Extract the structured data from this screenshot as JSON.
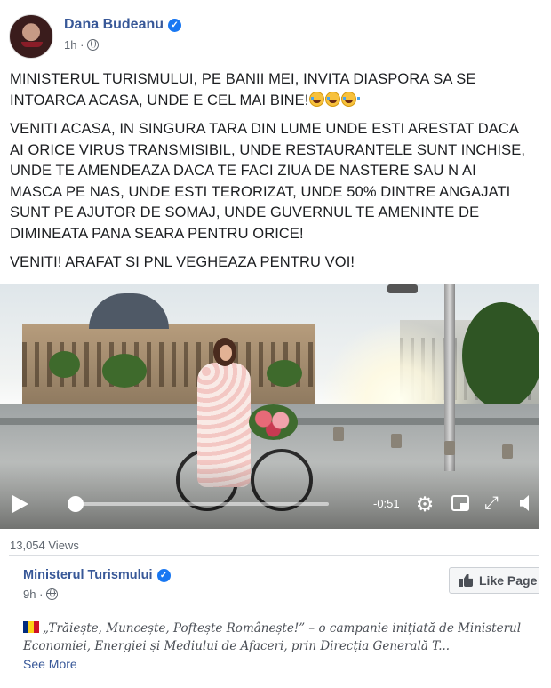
{
  "post": {
    "author": "Dana Budeanu",
    "time": "1h",
    "paragraphs": [
      "MINISTERUL TURISMULUI, PE BANII MEI, INVITA DIASPORA SA SE",
      "INTOARCA ACASA, UNDE E CEL MAI BINE!",
      "VENITI ACASA, IN SINGURA TARA DIN LUME UNDE ESTI ARESTAT DACA",
      "AI ORICE VIRUS TRANSMISIBIL, UNDE RESTAURANTELE SUNT INCHISE,",
      "UNDE TE AMENDEAZA DACA TE FACI ZIUA DE NASTERE SAU N AI",
      "MASCA PE NAS, UNDE ESTI TERORIZAT, UNDE 50% DINTRE ANGAJATI",
      "SUNT PE AJUTOR DE SOMAJ, UNDE GUVERNUL TE AMENINTE DE",
      "DIMINEATA PANA SEARA PENTRU ORICE!",
      "VENITI! ARAFAT SI PNL VEGHEAZA PENTRU VOI!"
    ]
  },
  "video": {
    "time_remaining": "-0:51",
    "progress": 0.01,
    "views": "13,054 Views"
  },
  "shared_page": {
    "name": "Ministerul Turismului",
    "time": "9h",
    "like_button": "Like Page",
    "description_line1": "„Trăiește, Muncește, Poftește Românește!” – o campanie inițiată de Ministerul",
    "description_line2": "Economiei, Energiei și Mediului de Afaceri, prin Direcția Generală T...",
    "see_more": "See More"
  },
  "icons": {
    "verified": "verified-badge-icon",
    "globe": "globe-icon",
    "settings": "gear-icon",
    "pip": "picture-in-picture-icon",
    "fullscreen": "fullscreen-icon",
    "volume": "volume-icon",
    "like": "thumbs-up-icon",
    "flag": "romania-flag-icon"
  },
  "colors": {
    "link": "#385898",
    "verified": "#1877f2",
    "meta": "#606770"
  }
}
